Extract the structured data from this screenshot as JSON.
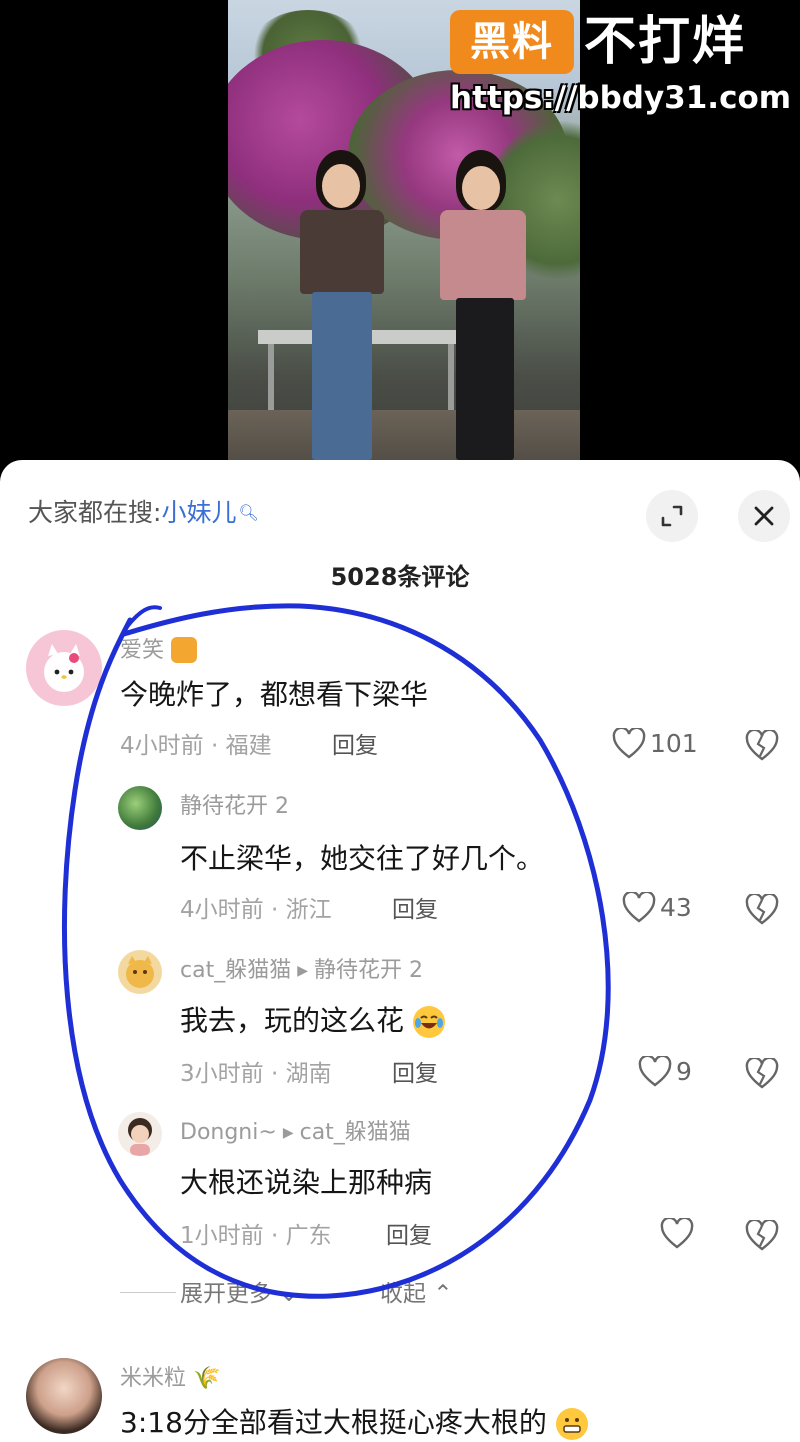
{
  "watermark": {
    "badge": "黑料",
    "title": "不打烊",
    "url": "https://bbdy31.com"
  },
  "sheet": {
    "search_prefix": "大家都在搜:",
    "search_term": "小妹儿",
    "comment_count": "5028条评论"
  },
  "comments": [
    {
      "name": "爱笑",
      "text": "今晚炸了，都想看下梁华",
      "time": "4小时前 · 福建",
      "reply": "回复",
      "likes": "101"
    },
    {
      "name": "静待花开 2",
      "text": "不止梁华，她交往了好几个。",
      "time": "4小时前 · 浙江",
      "reply": "回复",
      "likes": "43"
    },
    {
      "name": "cat_躲猫猫",
      "reply_to": "静待花开 2",
      "text": "我去，玩的这么花",
      "time": "3小时前 · 湖南",
      "reply": "回复",
      "likes": "9"
    },
    {
      "name": "Dongni~",
      "reply_to": "cat_躲猫猫",
      "text": "大根还说染上那种病",
      "time": "1小时前 · 广东",
      "reply": "回复",
      "likes": ""
    }
  ],
  "thread_controls": {
    "expand_more": "展开更多",
    "collapse": "收起"
  },
  "next_comment": {
    "name": "米米粒",
    "text": "3:18分全部看过大根挺心疼大根的"
  },
  "colors": {
    "link_blue": "#3b6fd4",
    "circle_blue": "#1f2fd6",
    "watermark_orange": "#f08a1c"
  }
}
